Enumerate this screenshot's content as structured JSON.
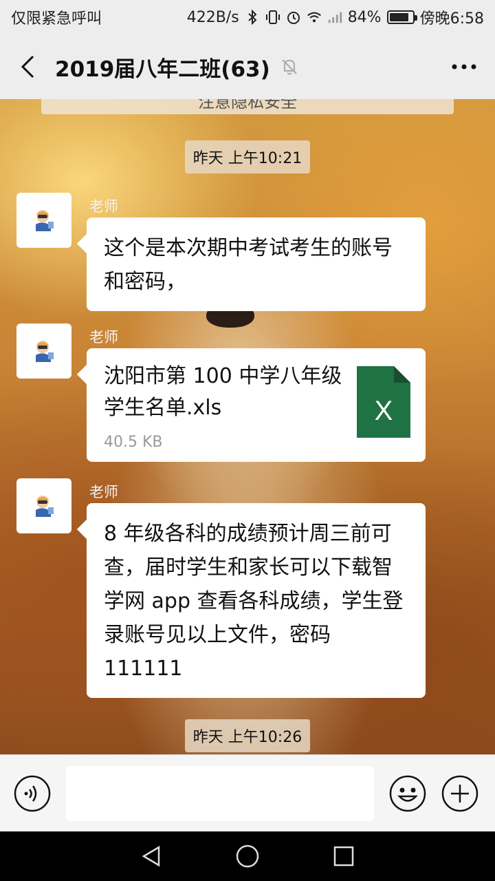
{
  "status_bar": {
    "carrier": "仅限紧急呼叫",
    "net_speed": "422B/s",
    "battery": "84%",
    "battery_level": 0.84,
    "time": "傍晚6:58"
  },
  "header": {
    "title": "2019届八年二班(63)",
    "back_icon": "back-arrow-icon",
    "mute_icon": "bell-muted-icon",
    "more_icon": "more-dots-icon"
  },
  "chat": {
    "banner": "注意隐私安全",
    "timestamp_1": "昨天 上午10:21",
    "messages": [
      {
        "sender": "老师",
        "text": "这个是本次期中考试考生的账号和密码，"
      },
      {
        "sender": "老师",
        "file_name": "沈阳市第 100 中学八年级学生名单.xls",
        "file_size": "40.5 KB",
        "file_icon_letter": "X"
      },
      {
        "sender": "老师",
        "text": "8 年级各科的成绩预计周三前可查，届时学生和家长可以下载智学网 app 查看各科成绩，学生登录账号见以上文件，密码 111111"
      }
    ],
    "timestamp_2": "昨天 上午10:26"
  },
  "colors": {
    "excel_green": "#1f7244",
    "bar_bg": "#ededed"
  }
}
